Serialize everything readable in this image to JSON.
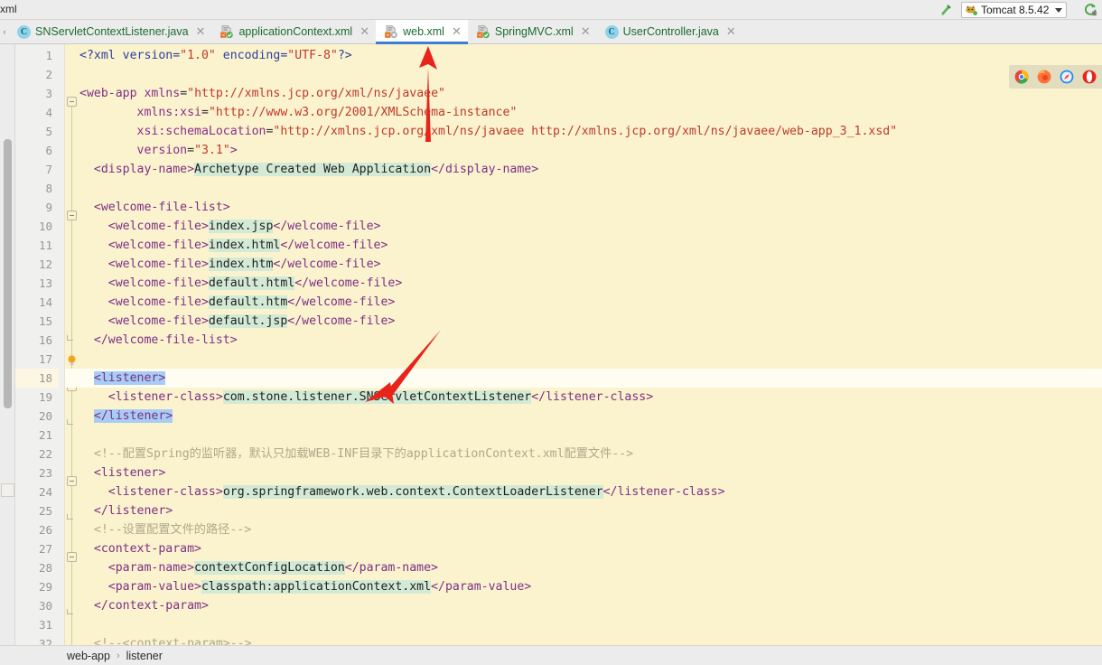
{
  "toolbar": {
    "left_label": "xml",
    "build_icon": "hammer-icon",
    "run_config_label": "Tomcat 8.5.42",
    "run_config_icon": "tomcat-cat-icon",
    "rerun_icon": "rerun-icon",
    "caret_icon": "chevron-down-icon"
  },
  "tabs": [
    {
      "label": "SNServletContextListener.java",
      "icon": "java-class-icon",
      "icon_letter": "C",
      "active": false,
      "close_icon": "close-icon"
    },
    {
      "label": "applicationContext.xml",
      "icon": "xml-file-icon",
      "active": false,
      "close_icon": "close-icon"
    },
    {
      "label": "web.xml",
      "icon": "xml-file-icon",
      "active": true,
      "close_icon": "close-icon"
    },
    {
      "label": "SpringMVC.xml",
      "icon": "xml-file-icon",
      "active": false,
      "close_icon": "close-icon"
    },
    {
      "label": "UserController.java",
      "icon": "java-class-icon",
      "icon_letter": "C",
      "active": false,
      "close_icon": "close-icon"
    }
  ],
  "browser_preview": {
    "icons": [
      "chrome-icon",
      "firefox-icon",
      "safari-icon",
      "opera-icon"
    ]
  },
  "editor": {
    "current_line": 18,
    "first_line": 1,
    "last_line": 32,
    "lines": [
      {
        "n": 1,
        "html": "<span class='t-prolog'>&lt;?xml version=<span class='t-val'>\"1.0\"</span> encoding=<span class='t-val'>\"UTF-8\"</span>?&gt;</span>"
      },
      {
        "n": 2,
        "html": ""
      },
      {
        "n": 3,
        "html": "<span class='t-tag'>&lt;web-app</span> <span class='t-attr'>xmlns</span>=<span class='t-val'>\"http://xmlns.jcp.org/xml/ns/javaee\"</span>"
      },
      {
        "n": 4,
        "html": "        <span class='t-attr'>xmlns:xsi</span>=<span class='t-val'>\"http://www.w3.org/2001/XMLSchema-instance\"</span>"
      },
      {
        "n": 5,
        "html": "        <span class='t-attr'>xsi:schemaLocation</span>=<span class='t-val'>\"http://xmlns.jcp.org/xml/ns/javaee http://xmlns.jcp.org/xml/ns/javaee/web-app_3_1.xsd\"</span>"
      },
      {
        "n": 6,
        "html": "        <span class='t-attr'>version</span>=<span class='t-val'>\"3.1\"</span><span class='t-tag'>&gt;</span>"
      },
      {
        "n": 7,
        "html": "  <span class='t-tag'>&lt;display-name&gt;</span><span class='t-text'>Archetype Created Web Application</span><span class='t-tag'>&lt;/display-name&gt;</span>"
      },
      {
        "n": 8,
        "html": ""
      },
      {
        "n": 9,
        "html": "  <span class='t-tag'>&lt;welcome-file-list&gt;</span>"
      },
      {
        "n": 10,
        "html": "    <span class='t-tag'>&lt;welcome-file&gt;</span><span class='t-text'>index.jsp</span><span class='t-tag'>&lt;/welcome-file&gt;</span>"
      },
      {
        "n": 11,
        "html": "    <span class='t-tag'>&lt;welcome-file&gt;</span><span class='t-text'>index.html</span><span class='t-tag'>&lt;/welcome-file&gt;</span>"
      },
      {
        "n": 12,
        "html": "    <span class='t-tag'>&lt;welcome-file&gt;</span><span class='t-text'>index.htm</span><span class='t-tag'>&lt;/welcome-file&gt;</span>"
      },
      {
        "n": 13,
        "html": "    <span class='t-tag'>&lt;welcome-file&gt;</span><span class='t-text'>default.html</span><span class='t-tag'>&lt;/welcome-file&gt;</span>"
      },
      {
        "n": 14,
        "html": "    <span class='t-tag'>&lt;welcome-file&gt;</span><span class='t-text'>default.htm</span><span class='t-tag'>&lt;/welcome-file&gt;</span>"
      },
      {
        "n": 15,
        "html": "    <span class='t-tag'>&lt;welcome-file&gt;</span><span class='t-text'>default.jsp</span><span class='t-tag'>&lt;/welcome-file&gt;</span>"
      },
      {
        "n": 16,
        "html": "  <span class='t-tag'>&lt;/welcome-file-list&gt;</span>"
      },
      {
        "n": 17,
        "html": ""
      },
      {
        "n": 18,
        "html": "  <span class='t-tag sel'>&lt;listener&gt;</span>"
      },
      {
        "n": 19,
        "html": "    <span class='t-tag'>&lt;listener-class&gt;</span><span class='t-text'>com.stone.listener.SNServletContextListener</span><span class='t-tag'>&lt;/listener-class&gt;</span>"
      },
      {
        "n": 20,
        "html": "  <span class='t-tag sel'>&lt;/listener&gt;</span>"
      },
      {
        "n": 21,
        "html": ""
      },
      {
        "n": 22,
        "html": "  <span class='t-cmt'>&lt;!--配置Spring的监听器，默认只加载WEB-INF目录下的applicationContext.xml配置文件--&gt;</span>"
      },
      {
        "n": 23,
        "html": "  <span class='t-tag'>&lt;listener&gt;</span>"
      },
      {
        "n": 24,
        "html": "    <span class='t-tag'>&lt;listener-class&gt;</span><span class='t-text'>org.springframework.web.context.ContextLoaderListener</span><span class='t-tag'>&lt;/listener-class&gt;</span>"
      },
      {
        "n": 25,
        "html": "  <span class='t-tag'>&lt;/listener&gt;</span>"
      },
      {
        "n": 26,
        "html": "  <span class='t-cmt'>&lt;!--设置配置文件的路径--&gt;</span>"
      },
      {
        "n": 27,
        "html": "  <span class='t-tag'>&lt;context-param&gt;</span>"
      },
      {
        "n": 28,
        "html": "    <span class='t-tag'>&lt;param-name&gt;</span><span class='t-text'>contextConfigLocation</span><span class='t-tag'>&lt;/param-name&gt;</span>"
      },
      {
        "n": 29,
        "html": "    <span class='t-tag'>&lt;param-value&gt;</span><span class='t-text'>classpath:applicationContext.xml</span><span class='t-tag'>&lt;/param-value&gt;</span>"
      },
      {
        "n": 30,
        "html": "  <span class='t-tag'>&lt;/context-param&gt;</span>"
      },
      {
        "n": 31,
        "html": ""
      },
      {
        "n": 32,
        "html": "  <span class='t-cmt'>&lt;!--&lt;context-param&gt;--&gt;</span>"
      }
    ],
    "intention_bulb_line": 17,
    "selected_text": "<listener> ... </listener>"
  },
  "annotations": [
    {
      "name": "arrow-to-web-xml-tab",
      "color": "#e8231a"
    },
    {
      "name": "arrow-to-listener-class",
      "color": "#e8231a"
    }
  ],
  "breadcrumb": {
    "items": [
      "web-app",
      "listener"
    ],
    "separator": "›"
  }
}
